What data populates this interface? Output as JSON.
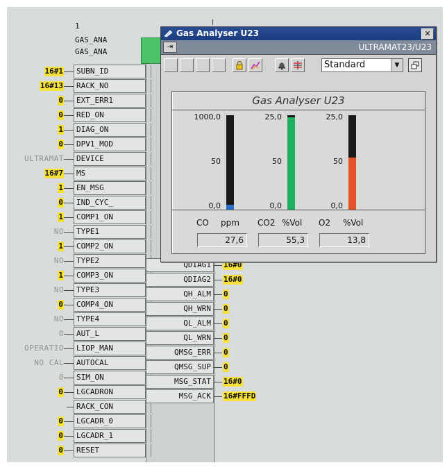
{
  "block": {
    "number": "1",
    "name1": "GAS_ANA",
    "name2": "GAS_ANA",
    "inputs": [
      {
        "pin": "SUBN_ID",
        "value": "16#1",
        "style": "hl"
      },
      {
        "pin": "RACK_NO",
        "value": "16#13",
        "style": "hl"
      },
      {
        "pin": "EXT_ERR1",
        "value": "0",
        "style": "hl"
      },
      {
        "pin": "RED_ON",
        "value": "0",
        "style": "hl"
      },
      {
        "pin": "DIAG_ON",
        "value": "1",
        "style": "hl"
      },
      {
        "pin": "DPV1_MOD",
        "value": "0",
        "style": "hl"
      },
      {
        "pin": "DEVICE",
        "value": "ULTRAMAT",
        "style": "dim"
      },
      {
        "pin": "MS",
        "value": "16#7",
        "style": "hl"
      },
      {
        "pin": "EN_MSG",
        "value": "1",
        "style": "hl"
      },
      {
        "pin": "IND_CYC_",
        "value": "0",
        "style": "hl"
      },
      {
        "pin": "COMP1_ON",
        "value": "1",
        "style": "hl"
      },
      {
        "pin": "TYPE1",
        "value": "NO",
        "style": "dim"
      },
      {
        "pin": "COMP2_ON",
        "value": "1",
        "style": "hl"
      },
      {
        "pin": "TYPE2",
        "value": "NO",
        "style": "dim"
      },
      {
        "pin": "COMP3_ON",
        "value": "1",
        "style": "hl"
      },
      {
        "pin": "TYPE3",
        "value": "NO",
        "style": "dim"
      },
      {
        "pin": "COMP4_ON",
        "value": "0",
        "style": "hl"
      },
      {
        "pin": "TYPE4",
        "value": "NO",
        "style": "dim"
      },
      {
        "pin": "AUT_L",
        "value": "0",
        "style": "dim"
      },
      {
        "pin": "LIOP_MAN",
        "value": "OPERATIO",
        "style": "dim"
      },
      {
        "pin": "AUTOCAL",
        "value": "NO CAL",
        "style": "dim"
      },
      {
        "pin": "SIM_ON",
        "value": "0",
        "style": "dim"
      },
      {
        "pin": "LGCADRON",
        "value": "0",
        "style": "hl"
      },
      {
        "pin": "RACK_CON",
        "value": "",
        "style": "none"
      },
      {
        "pin": "LGCADR_0",
        "value": "0",
        "style": "hl"
      },
      {
        "pin": "LGCADR_1",
        "value": "0",
        "style": "hl"
      },
      {
        "pin": "RESET",
        "value": "0",
        "style": "hl"
      }
    ],
    "outputs": [
      {
        "pin": "QDIAG1",
        "value": "16#0"
      },
      {
        "pin": "QDIAG2",
        "value": "16#0"
      },
      {
        "pin": "QH_ALM",
        "value": "0"
      },
      {
        "pin": "QH_WRN",
        "value": "0"
      },
      {
        "pin": "QL_ALM",
        "value": "0"
      },
      {
        "pin": "QL_WRN",
        "value": "0"
      },
      {
        "pin": "QMSG_ERR",
        "value": "0"
      },
      {
        "pin": "QMSG_SUP",
        "value": "0"
      },
      {
        "pin": "MSG_STAT",
        "value": "16#0"
      },
      {
        "pin": "MSG_ACK",
        "value": "16#FFFD"
      }
    ]
  },
  "window": {
    "title": "Gas Analyser U23",
    "path": "ULTRAMAT23/U23",
    "view_select": "Standard",
    "panel_title": "Gas Analyser U23",
    "accent_color": "#1b3c7e",
    "channels": [
      {
        "name": "CO",
        "unit": "ppm",
        "scale_max": "1000,0",
        "scale_mid": "50",
        "scale_min": "0,0",
        "value": "27,6",
        "fraction": 0.05,
        "color": "#2a6fc9"
      },
      {
        "name": "CO2",
        "unit": "%Vol",
        "scale_max": "25,0",
        "scale_mid": "50",
        "scale_min": "0,0",
        "value": "55,3",
        "fraction": 0.98,
        "color": "#20b060"
      },
      {
        "name": "O2",
        "unit": "%Vol",
        "scale_max": "25,0",
        "scale_mid": "50",
        "scale_min": "0,0",
        "value": "13,8",
        "fraction": 0.55,
        "color": "#e4522a"
      }
    ]
  }
}
